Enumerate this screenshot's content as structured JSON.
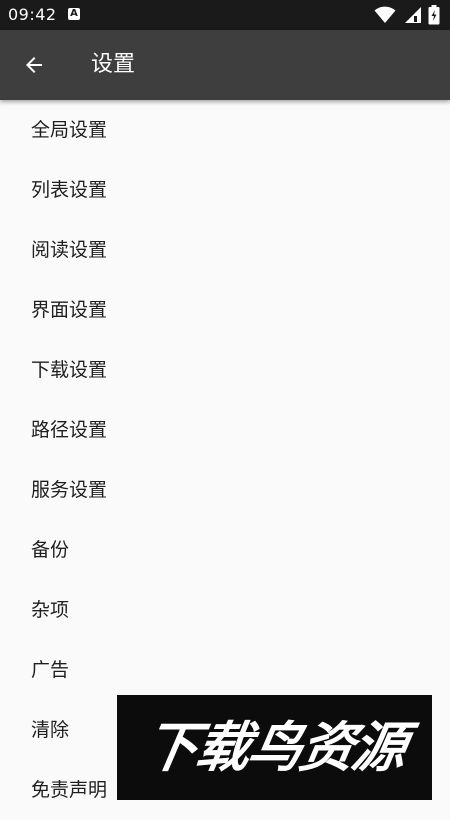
{
  "status_bar": {
    "time": "09:42",
    "app_notification_letter": "A"
  },
  "header": {
    "title": "设置"
  },
  "settings_items": [
    {
      "label": "全局设置"
    },
    {
      "label": "列表设置"
    },
    {
      "label": "阅读设置"
    },
    {
      "label": "界面设置"
    },
    {
      "label": "下载设置"
    },
    {
      "label": "路径设置"
    },
    {
      "label": "服务设置"
    },
    {
      "label": "备份"
    },
    {
      "label": "杂项"
    },
    {
      "label": "广告"
    },
    {
      "label": "清除"
    },
    {
      "label": "免责声明"
    }
  ],
  "watermark": {
    "text": "下载鸟资源"
  },
  "colors": {
    "status_bar_bg": "#1a1a1a",
    "app_bar_bg": "#3e3e3e",
    "list_bg": "#fafafa",
    "text_primary": "#1f1f1f"
  },
  "icons": {
    "back": "arrow-left-icon",
    "wifi": "wifi-icon",
    "signal": "cell-signal-icon",
    "battery": "battery-charging-icon"
  }
}
